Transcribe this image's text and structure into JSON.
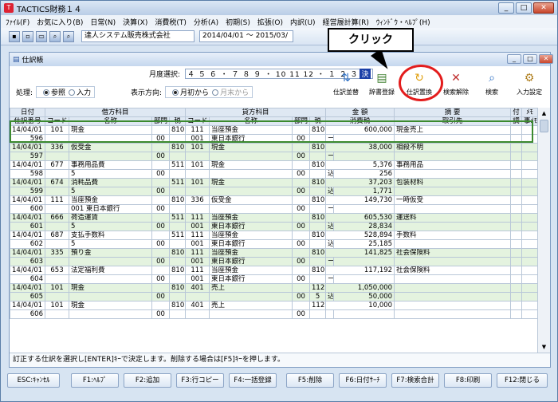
{
  "window": {
    "title": "TACTICS財務１４"
  },
  "menu": [
    "ﾌｧｲﾙ(F)",
    "お気に入り(B)",
    "日常(N)",
    "決算(X)",
    "消費税(T)",
    "分析(A)",
    "初期(S)",
    "拡張(O)",
    "内訳(U)",
    "経営履計算(R)",
    "ｳｨﾝﾄﾞｳ・ﾍﾙﾌﾟ(H)"
  ],
  "toolbar": {
    "company": "達人システム販売株式会社",
    "period": "2014/04/01 ～ 2015/03/"
  },
  "callout": {
    "text": "クリック"
  },
  "sub_window": {
    "title": "仕訳帳"
  },
  "controls": {
    "month_label": "月度選択:",
    "months": "４ ５ ６ ・ ７ ８ ９ ・ 10 11 12 ・ １ ２ ３",
    "month_selected": "決",
    "mode_label": "処理:",
    "mode_options": [
      "参照",
      "入力"
    ],
    "direction_label": "表示方向:",
    "direction_options": [
      "月初から",
      "月末から"
    ]
  },
  "actions": [
    {
      "label": "仕訳並替",
      "icon": "sort-journal-icon"
    },
    {
      "label": "辞書登録",
      "icon": "dictionary-icon"
    },
    {
      "label": "仕訳置換",
      "icon": "replace-icon"
    },
    {
      "label": "検索解除",
      "icon": "clear-search-icon"
    },
    {
      "label": "検索",
      "icon": "search-icon"
    },
    {
      "label": "入力設定",
      "icon": "input-settings-icon"
    }
  ],
  "table": {
    "group_headers": [
      "日付",
      "借方科目",
      "貸方科目",
      "金 額",
      "摘 要",
      "付",
      "ﾒﾓ"
    ],
    "sub_headers": [
      "仕訳番号",
      "コード",
      "名称",
      "部門",
      "税",
      "コード",
      "名称",
      "部門",
      "税",
      "消費税",
      "取引先",
      "調",
      "事ﾒﾓ"
    ],
    "entries": [
      {
        "date": "14/04/01",
        "no": "596",
        "dr_code": "101",
        "dr_name": "現金",
        "dr_sub": "",
        "dr_dept": "00",
        "dr_tax": "810",
        "cr_code": "111",
        "cr_name": "当座預金",
        "cr_sub_code": "001",
        "cr_sub": "東日本銀行",
        "cr_dept": "00",
        "cr_tax": "810",
        "tax_mark": "ー",
        "amount": "600,000",
        "tax_amount": "",
        "memo": "現金売上"
      },
      {
        "date": "14/04/01",
        "no": "597",
        "dr_code": "336",
        "dr_name": "仮受金",
        "dr_sub": "",
        "dr_dept": "00",
        "dr_tax": "810",
        "cr_code": "101",
        "cr_name": "現金",
        "cr_sub_code": "",
        "cr_sub": "",
        "cr_dept": "00",
        "cr_tax": "810",
        "tax_mark": "ー",
        "amount": "38,000",
        "tax_amount": "",
        "memo": "相殺不明"
      },
      {
        "date": "14/04/01",
        "no": "598",
        "dr_code": "677",
        "dr_name": "事務用品費",
        "dr_sub": "5",
        "dr_dept": "00",
        "dr_tax": "511",
        "cr_code": "101",
        "cr_name": "現金",
        "cr_sub_code": "",
        "cr_sub": "",
        "cr_dept": "00",
        "cr_tax": "810",
        "tax_mark": "込",
        "amount": "5,376",
        "tax_amount": "256",
        "memo": "事務用品"
      },
      {
        "date": "14/04/01",
        "no": "599",
        "dr_code": "674",
        "dr_name": "消耗品費",
        "dr_sub": "5",
        "dr_dept": "00",
        "dr_tax": "511",
        "cr_code": "101",
        "cr_name": "現金",
        "cr_sub_code": "",
        "cr_sub": "",
        "cr_dept": "00",
        "cr_tax": "810",
        "tax_mark": "込",
        "amount": "37,203",
        "tax_amount": "1,771",
        "memo": "包装材料"
      },
      {
        "date": "14/04/01",
        "no": "600",
        "dr_code": "111",
        "dr_name": "当座預金",
        "dr_sub": "001 東日本銀行",
        "dr_dept": "00",
        "dr_tax": "810",
        "cr_code": "336",
        "cr_name": "仮受金",
        "cr_sub_code": "",
        "cr_sub": "",
        "cr_dept": "00",
        "cr_tax": "810",
        "tax_mark": "ー",
        "amount": "149,730",
        "tax_amount": "",
        "memo": "一時仮受"
      },
      {
        "date": "14/04/01",
        "no": "601",
        "dr_code": "666",
        "dr_name": "荷造運賃",
        "dr_sub": "5",
        "dr_dept": "00",
        "dr_tax": "511",
        "cr_code": "111",
        "cr_name": "当座預金",
        "cr_sub_code": "001",
        "cr_sub": "東日本銀行",
        "cr_dept": "00",
        "cr_tax": "810",
        "tax_mark": "込",
        "amount": "605,530",
        "tax_amount": "28,834",
        "memo": "運送料"
      },
      {
        "date": "14/04/01",
        "no": "602",
        "dr_code": "687",
        "dr_name": "支払手数料",
        "dr_sub": "5",
        "dr_dept": "00",
        "dr_tax": "511",
        "cr_code": "111",
        "cr_name": "当座預金",
        "cr_sub_code": "001",
        "cr_sub": "東日本銀行",
        "cr_dept": "00",
        "cr_tax": "810",
        "tax_mark": "込",
        "amount": "528,894",
        "tax_amount": "25,185",
        "memo": "手数料"
      },
      {
        "date": "14/04/01",
        "no": "603",
        "dr_code": "335",
        "dr_name": "預り金",
        "dr_sub": "",
        "dr_dept": "00",
        "dr_tax": "810",
        "cr_code": "111",
        "cr_name": "当座預金",
        "cr_sub_code": "001",
        "cr_sub": "東日本銀行",
        "cr_dept": "00",
        "cr_tax": "810",
        "tax_mark": "ー",
        "amount": "141,825",
        "tax_amount": "",
        "memo": "社会保険料"
      },
      {
        "date": "14/04/01",
        "no": "604",
        "dr_code": "653",
        "dr_name": "法定福利費",
        "dr_sub": "",
        "dr_dept": "00",
        "dr_tax": "810",
        "cr_code": "111",
        "cr_name": "当座預金",
        "cr_sub_code": "001",
        "cr_sub": "東日本銀行",
        "cr_dept": "00",
        "cr_tax": "810",
        "tax_mark": "ー",
        "amount": "117,192",
        "tax_amount": "",
        "memo": "社会保険料"
      },
      {
        "date": "14/04/01",
        "no": "605",
        "dr_code": "101",
        "dr_name": "現金",
        "dr_sub": "",
        "dr_dept": "00",
        "dr_tax": "810",
        "cr_code": "401",
        "cr_name": "売上",
        "cr_sub_code": "",
        "cr_sub": "",
        "cr_dept": "00",
        "cr_tax": "112",
        "tax_mark": "込",
        "amount": "1,050,000",
        "tax_amount": "50,000",
        "memo": "",
        "cr_sub_num": "5"
      },
      {
        "date": "14/04/01",
        "no": "606",
        "dr_code": "101",
        "dr_name": "現金",
        "dr_sub": "",
        "dr_dept": "00",
        "dr_tax": "810",
        "cr_code": "401",
        "cr_name": "売上",
        "cr_sub_code": "",
        "cr_sub": "",
        "cr_dept": "00",
        "cr_tax": "112",
        "tax_mark": "",
        "amount": "10,000",
        "tax_amount": "",
        "memo": ""
      }
    ]
  },
  "status": "訂正する仕訳を選択し[ENTER]ｷｰで決定します。削除する場合は[F5]ｷｰを押します。",
  "fkeys": [
    "ESC:ｷｬﾝｾﾙ",
    "F1:ﾍﾙﾌﾟ",
    "F2:追加",
    "F3:行コピー",
    "F4:一括登録",
    "F5:削除",
    "F6:日付ｻｰﾁ",
    "F7:検索合計",
    "F8:印刷",
    "F12:閉じる"
  ],
  "colors": {
    "highlight": "#3b8a2e",
    "circle": "#e31c1c",
    "row_alt": "#e4f3df"
  }
}
